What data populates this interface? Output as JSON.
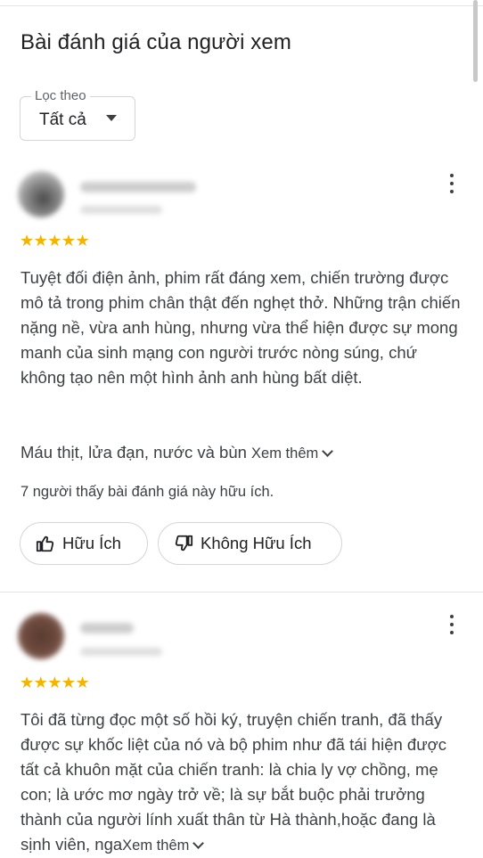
{
  "panel": {
    "title": "Bài đánh giá của người xem"
  },
  "filter": {
    "label": "Lọc theo",
    "value": "Tất cả"
  },
  "reviews": [
    {
      "stars": "★★★★★",
      "text": "Tuyệt đối điện ảnh, phim rất đáng xem, chiến trường được mô tả trong phim chân thật đến nghẹt thở. Những trận chiến nặng nề, vừa anh hùng, nhưng vừa thể hiện được sự mong manh của sinh mạng con người trước nòng súng, chứ không tạo nên một hình ảnh anh hùng bất diệt.",
      "text2": "Máu thịt, lửa đạn, nước và bùn ",
      "more": "Xem thêm",
      "helpful_count": "7 người thấy bài đánh giá này hữu ích.",
      "helpful_label": "Hữu Ích",
      "not_helpful_label": "Không Hữu Ích"
    },
    {
      "stars": "★★★★★",
      "text": "Tôi đã từng đọc một số hồi ký, truyện chiến tranh, đã thấy được sự khốc liệt của nó và bộ phim như đã tái hiện được tất cả khuôn mặt của chiến tranh: là chia ly vợ chồng, mẹ con; là ước mơ ngày trở về; là sự bắt buộc phải trưởng thành của người lính xuất thân từ Hà thành,hoặc  đang là sịnh viên, nga",
      "more": "Xem thêm"
    }
  ],
  "colors": {
    "star": "#f5b400",
    "text": "#3c4043",
    "border": "#d3d5d9"
  }
}
